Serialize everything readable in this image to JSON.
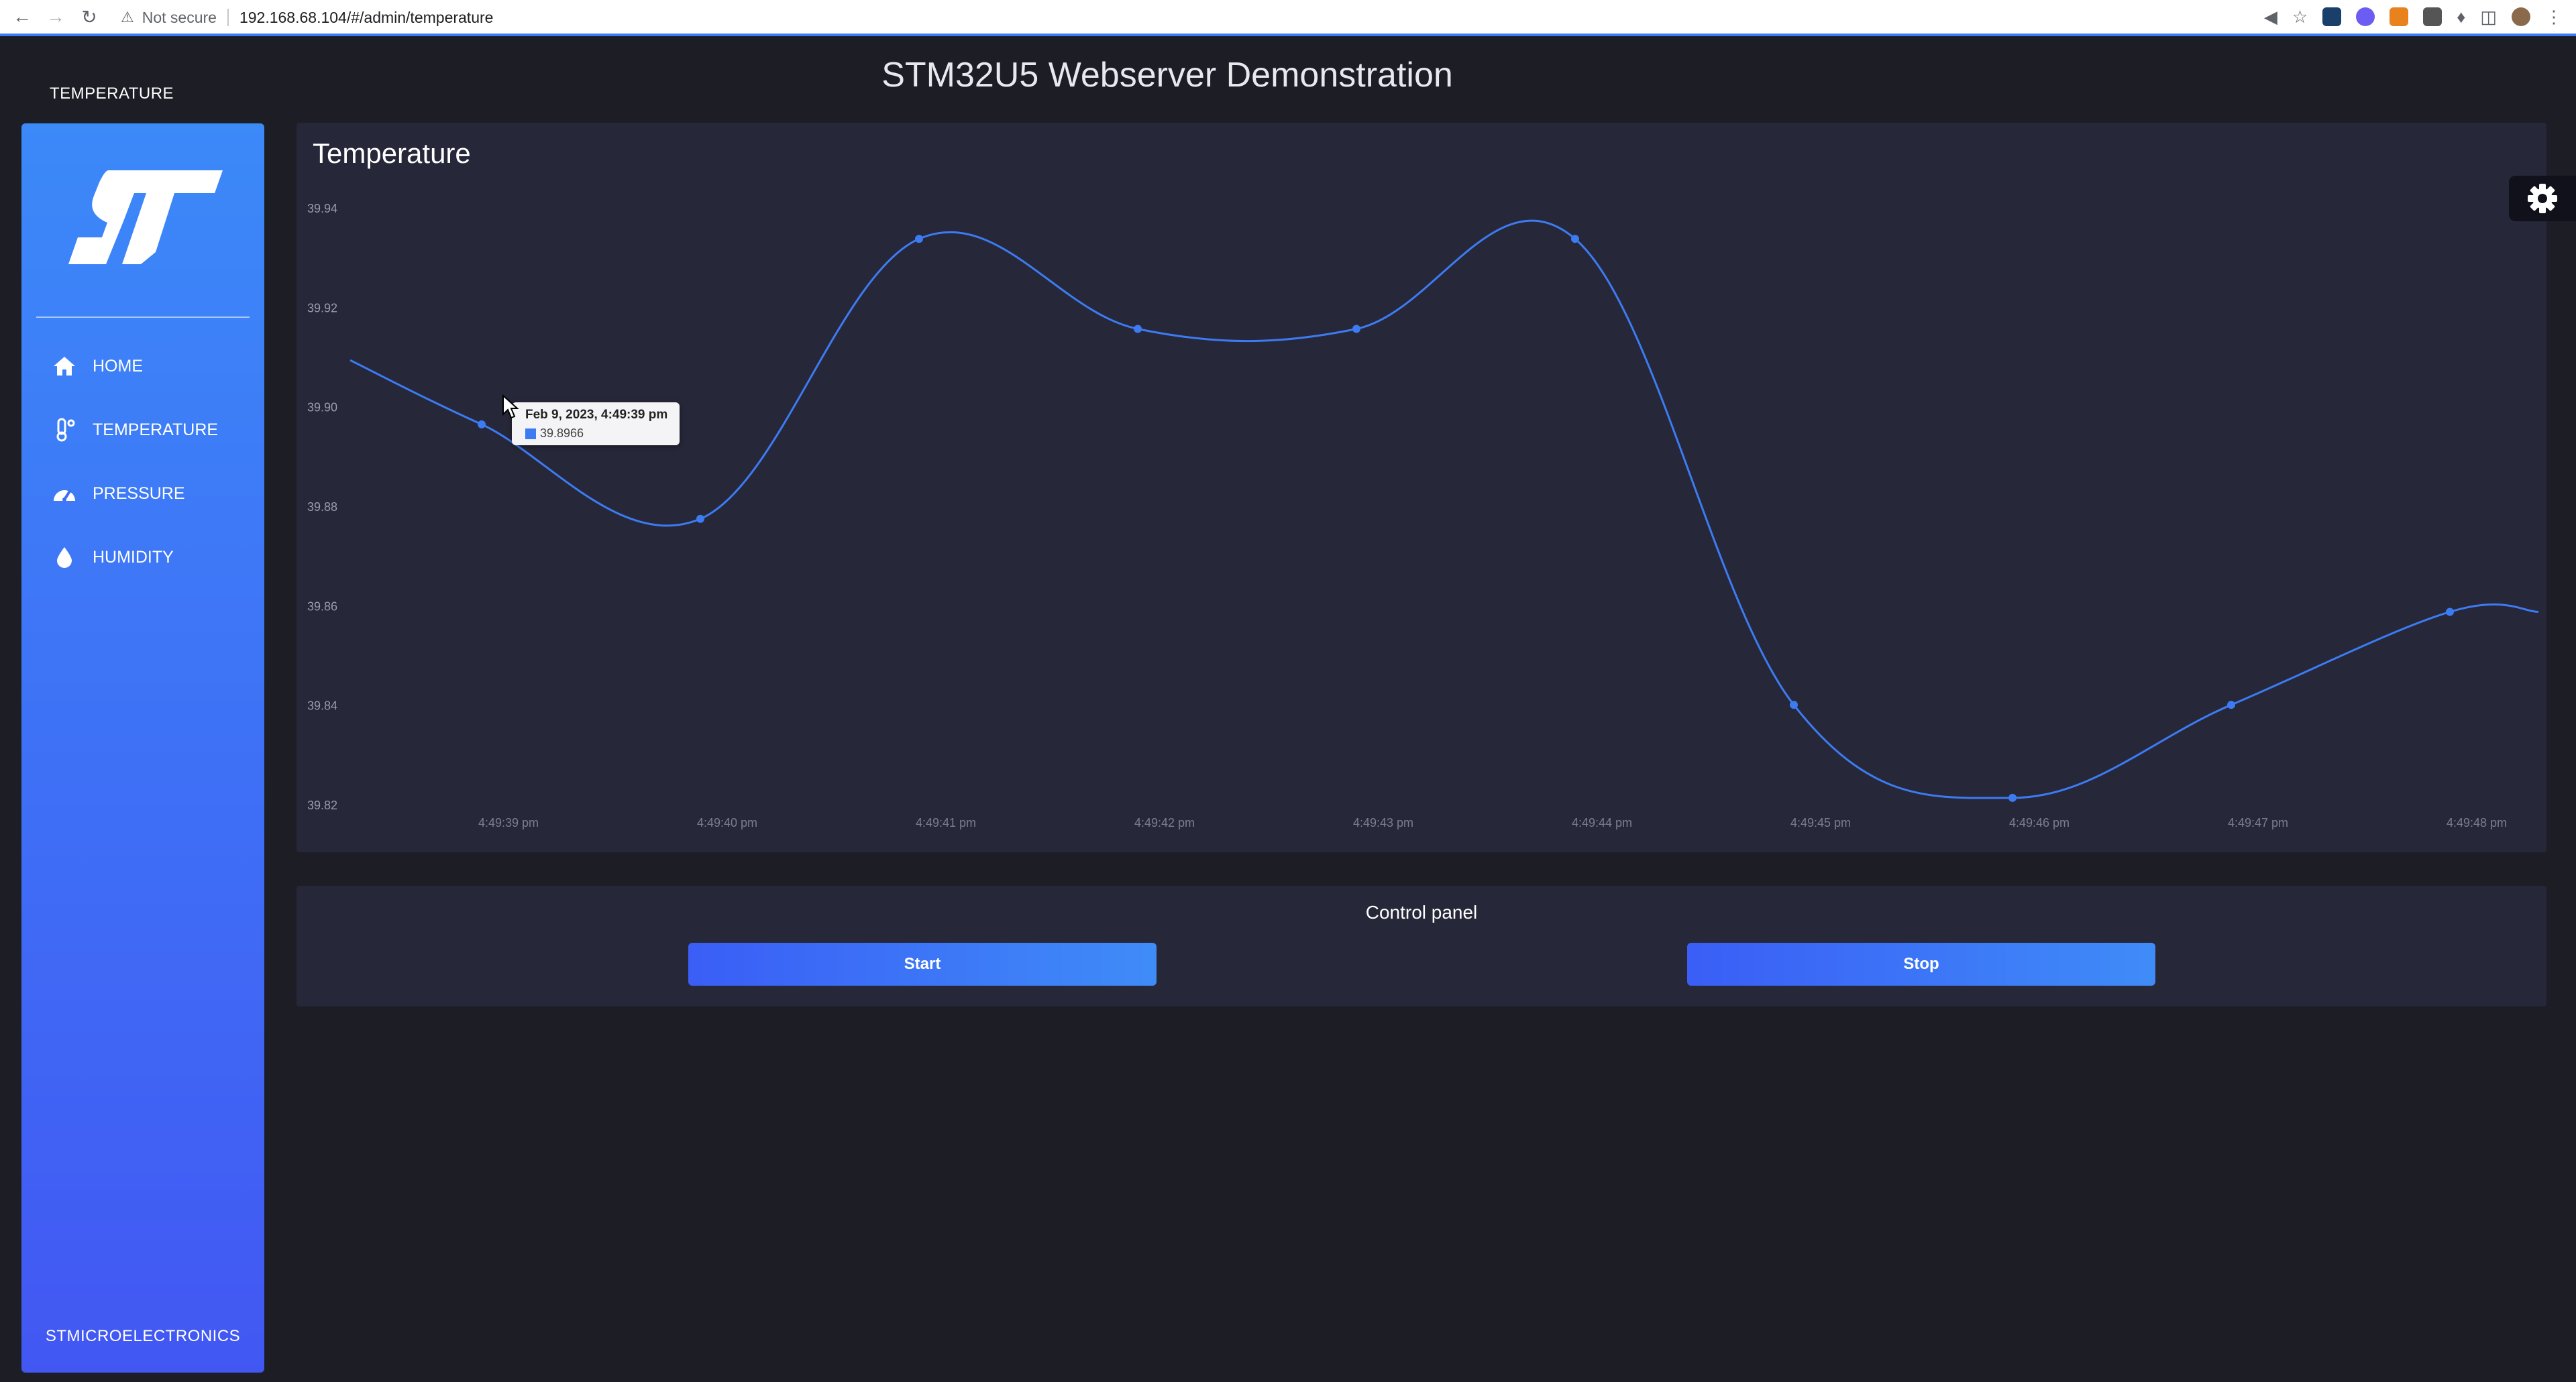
{
  "browser": {
    "security_label": "Not secure",
    "url": "192.168.68.104/#/admin/temperature"
  },
  "app": {
    "title": "STM32U5 Webserver Demonstration",
    "section_title": "TEMPERATURE"
  },
  "sidebar": {
    "items": [
      {
        "label": "HOME",
        "icon": "home-icon"
      },
      {
        "label": "TEMPERATURE",
        "icon": "thermometer-icon"
      },
      {
        "label": "PRESSURE",
        "icon": "gauge-icon"
      },
      {
        "label": "HUMIDITY",
        "icon": "droplet-icon"
      }
    ],
    "footer": "STMICROELECTRONICS"
  },
  "chart_card": {
    "title": "Temperature"
  },
  "chart_data": {
    "type": "area",
    "title": "Temperature",
    "xlabel": "",
    "ylabel": "",
    "ylim": [
      39.82,
      39.94
    ],
    "yticks": [
      "39.94",
      "39.92",
      "39.90",
      "39.88",
      "39.86",
      "39.84",
      "39.82"
    ],
    "categories": [
      "4:49:39 pm",
      "4:49:40 pm",
      "4:49:41 pm",
      "4:49:42 pm",
      "4:49:43 pm",
      "4:49:44 pm",
      "4:49:45 pm",
      "4:49:46 pm",
      "4:49:47 pm",
      "4:49:48 pm"
    ],
    "series": [
      {
        "color": "#3d7bf2",
        "values": [
          39.8966,
          39.8776,
          39.9339,
          39.9158,
          39.9158,
          39.9339,
          39.8402,
          39.8215,
          39.8402,
          39.8589
        ]
      }
    ],
    "lead_in_value": 39.9095,
    "tail_value": 39.8589,
    "grid": false,
    "legend": "none"
  },
  "tooltip": {
    "title": "Feb 9, 2023, 4:49:39 pm",
    "value": "39.8966"
  },
  "control_panel": {
    "title": "Control panel",
    "start_label": "Start",
    "stop_label": "Stop"
  }
}
